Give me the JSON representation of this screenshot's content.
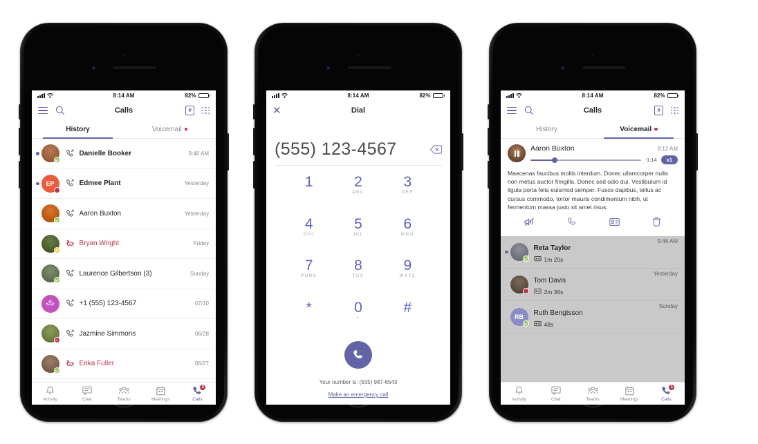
{
  "meta": {
    "app": "Microsoft Teams",
    "accent_color": "#6264a7",
    "missed_color": "#c4314b",
    "available_color": "#92c353",
    "away_color": "#f8d22a"
  },
  "status_bar": {
    "time": "8:14 AM",
    "battery_percent": "82%",
    "signal_icon": "cellular-bars-icon",
    "wifi_icon": "wifi-icon",
    "battery_icon": "battery-icon"
  },
  "phone1": {
    "header": {
      "title": "Calls",
      "menu_icon": "hamburger-menu-icon",
      "search_icon": "search-icon",
      "dialpad_badge_icon": "dialpad-badge-icon",
      "dialpad_badge_label": "#",
      "grid_icon": "nine-dot-grid-icon"
    },
    "tabs": [
      {
        "label": "History",
        "active": true,
        "has_dot": false
      },
      {
        "label": "Voicemail",
        "active": false,
        "has_dot": true
      }
    ],
    "calls": [
      {
        "name": "Danielle Booker",
        "time": "9:46 AM",
        "unread": true,
        "bold": true,
        "missed": false,
        "type_icon": "incoming-call-icon",
        "avatar_type": "photo",
        "avatar_color": "#b97a55",
        "initials": "",
        "presence": "available"
      },
      {
        "name": "Edmee Plant",
        "time": "Yesterday",
        "unread": true,
        "bold": true,
        "missed": false,
        "type_icon": "incoming-call-icon",
        "avatar_type": "initials",
        "avatar_color": "#ec5b39",
        "initials": "EP",
        "presence": "busy"
      },
      {
        "name": "Aaron Buxton",
        "time": "Yesterday",
        "unread": false,
        "bold": false,
        "missed": false,
        "type_icon": "incoming-call-icon",
        "avatar_type": "photo",
        "avatar_color": "#d9762e",
        "initials": "",
        "presence": "available"
      },
      {
        "name": "Bryan Wright",
        "time": "Friday",
        "unread": false,
        "bold": false,
        "missed": true,
        "type_icon": "missed-call-icon",
        "avatar_type": "photo",
        "avatar_color": "#6a7c4a",
        "initials": "",
        "presence": "away"
      },
      {
        "name": "Laurence Gilbertson (3)",
        "time": "Sunday",
        "unread": false,
        "bold": false,
        "missed": false,
        "type_icon": "incoming-call-icon",
        "avatar_type": "photo",
        "avatar_color": "#7d8f6e",
        "initials": "",
        "presence": "available"
      },
      {
        "name": "+1 (555) 123-4567",
        "time": "07/10",
        "unread": false,
        "bold": false,
        "missed": false,
        "type_icon": "incoming-call-icon",
        "avatar_type": "group",
        "avatar_color": "#c252bd",
        "initials": "",
        "presence": "none"
      },
      {
        "name": "Jazmine Simmons",
        "time": "06/28",
        "unread": false,
        "bold": false,
        "missed": false,
        "type_icon": "incoming-call-icon",
        "avatar_type": "photo",
        "avatar_color": "#8a9b5a",
        "initials": "",
        "presence": "dnd"
      },
      {
        "name": "Erika Fuller",
        "time": "06/27",
        "unread": false,
        "bold": false,
        "missed": true,
        "type_icon": "missed-call-icon",
        "avatar_type": "photo",
        "avatar_color": "#9a7f6a",
        "initials": "",
        "presence": "available"
      }
    ],
    "bottom_nav": [
      {
        "label": "Activity",
        "icon": "bell-icon",
        "active": false,
        "badge": ""
      },
      {
        "label": "Chat",
        "icon": "chat-bubble-icon",
        "active": false,
        "badge": ""
      },
      {
        "label": "Teams",
        "icon": "teams-people-icon",
        "active": false,
        "badge": ""
      },
      {
        "label": "Meetings",
        "icon": "calendar-icon",
        "active": false,
        "badge": ""
      },
      {
        "label": "Calls",
        "icon": "phone-icon",
        "active": true,
        "badge": "2"
      }
    ]
  },
  "phone2": {
    "header": {
      "title": "Dial",
      "close_icon": "close-x-icon"
    },
    "number": "(555) 123-4567",
    "backspace_icon": "backspace-delete-icon",
    "keys": [
      {
        "digit": "1",
        "letters": ""
      },
      {
        "digit": "2",
        "letters": "ABC"
      },
      {
        "digit": "3",
        "letters": "DEF"
      },
      {
        "digit": "4",
        "letters": "GHI"
      },
      {
        "digit": "5",
        "letters": "JKL"
      },
      {
        "digit": "6",
        "letters": "MNO"
      },
      {
        "digit": "7",
        "letters": "PQRS"
      },
      {
        "digit": "8",
        "letters": "TUV"
      },
      {
        "digit": "9",
        "letters": "WXYZ"
      },
      {
        "digit": "*",
        "letters": ""
      },
      {
        "digit": "0",
        "letters": "+"
      },
      {
        "digit": "#",
        "letters": ""
      }
    ],
    "call_button_icon": "phone-call-icon",
    "your_number_text": "Your number is: (555) 987-6543",
    "emergency_link": "Make an emergency call"
  },
  "phone3": {
    "header": {
      "title": "Calls",
      "menu_icon": "hamburger-menu-icon",
      "search_icon": "search-icon",
      "dialpad_badge_label": "#",
      "grid_icon": "nine-dot-grid-icon"
    },
    "tabs": [
      {
        "label": "History",
        "active": false,
        "has_dot": false
      },
      {
        "label": "Voicemail",
        "active": true,
        "has_dot": true
      }
    ],
    "expanded_voicemail": {
      "name": "Aaron Buxton",
      "time": "8:12 AM",
      "remaining": "-1:14",
      "speed": "x1",
      "progress_percent": 22,
      "pause_icon": "pause-icon",
      "transcript": "Maecenas faucibus mollis interdum. Donec ullamcorper nulla non metus auctor fringilla. Donec sed odio dui. Vestibulum id ligula porta felis euismod semper. Fusce dapibus, tellus ac cursus commodo, tortor mauris condimentum nibh, ut fermentum massa justo sit amet risus.",
      "actions": [
        {
          "icon": "mute-speaker-icon",
          "name": "speaker-mute-action"
        },
        {
          "icon": "phone-icon",
          "name": "call-back-action"
        },
        {
          "icon": "contact-card-icon",
          "name": "contact-card-action"
        },
        {
          "icon": "trash-icon",
          "name": "delete-voicemail-action"
        }
      ]
    },
    "voicemails": [
      {
        "name": "Reta Taylor",
        "duration": "1m 20s",
        "time": "9:46 AM",
        "unread": true,
        "avatar_type": "photo",
        "avatar_color": "#8d8f9a",
        "initials": "",
        "presence": "available"
      },
      {
        "name": "Tom Davis",
        "duration": "2m 36s",
        "time": "Yesterday",
        "unread": false,
        "avatar_type": "photo",
        "avatar_color": "#7a6a5c",
        "initials": "",
        "presence": "busy"
      },
      {
        "name": "Ruth Bengtsson",
        "duration": "48s",
        "time": "Sunday",
        "unread": false,
        "avatar_type": "initials",
        "avatar_color": "#8b8cc7",
        "initials": "RB",
        "presence": "available"
      }
    ],
    "bottom_nav": [
      {
        "label": "Activity",
        "icon": "bell-icon",
        "active": false,
        "badge": ""
      },
      {
        "label": "Chat",
        "icon": "chat-bubble-icon",
        "active": false,
        "badge": ""
      },
      {
        "label": "Teams",
        "icon": "teams-people-icon",
        "active": false,
        "badge": ""
      },
      {
        "label": "Meetings",
        "icon": "calendar-icon",
        "active": false,
        "badge": ""
      },
      {
        "label": "Calls",
        "icon": "phone-icon",
        "active": true,
        "badge": "1"
      }
    ]
  }
}
